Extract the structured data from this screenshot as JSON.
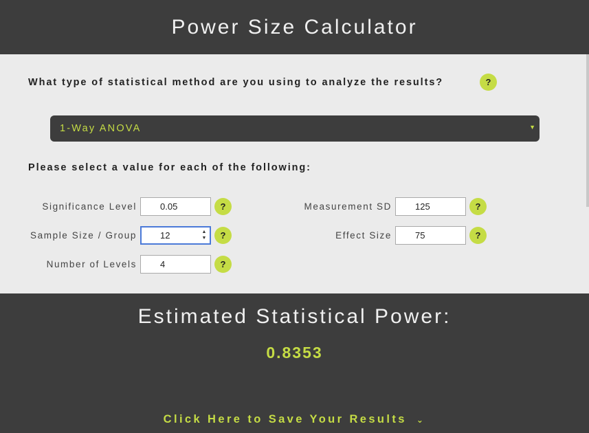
{
  "header": {
    "title": "Power Size Calculator"
  },
  "method_question": {
    "text": "What type of statistical method are you using to analyze the results?",
    "help": "?"
  },
  "method_select": {
    "value": "1-Way ANOVA",
    "arrow": "▼"
  },
  "params_prompt": "Please select a value for each of the following:",
  "fields": {
    "significance": {
      "label": "Significance Level",
      "value": "0.05",
      "help": "?"
    },
    "sample_size": {
      "label": "Sample Size / Group",
      "value": "12",
      "help": "?"
    },
    "levels": {
      "label": "Number of Levels",
      "value": "4",
      "help": "?"
    },
    "measurement_sd": {
      "label": "Measurement SD",
      "value": "125",
      "help": "?"
    },
    "effect_size": {
      "label": "Effect Size",
      "value": "75",
      "help": "?"
    }
  },
  "result": {
    "title": "Estimated Statistical Power:",
    "value": "0.8353"
  },
  "save": {
    "label": "Click Here to Save Your Results",
    "chevron": "⌄"
  },
  "colors": {
    "accent": "#c5dc45",
    "dark": "#3d3d3d",
    "panel": "#ebebeb",
    "focus": "#4a79d8"
  }
}
